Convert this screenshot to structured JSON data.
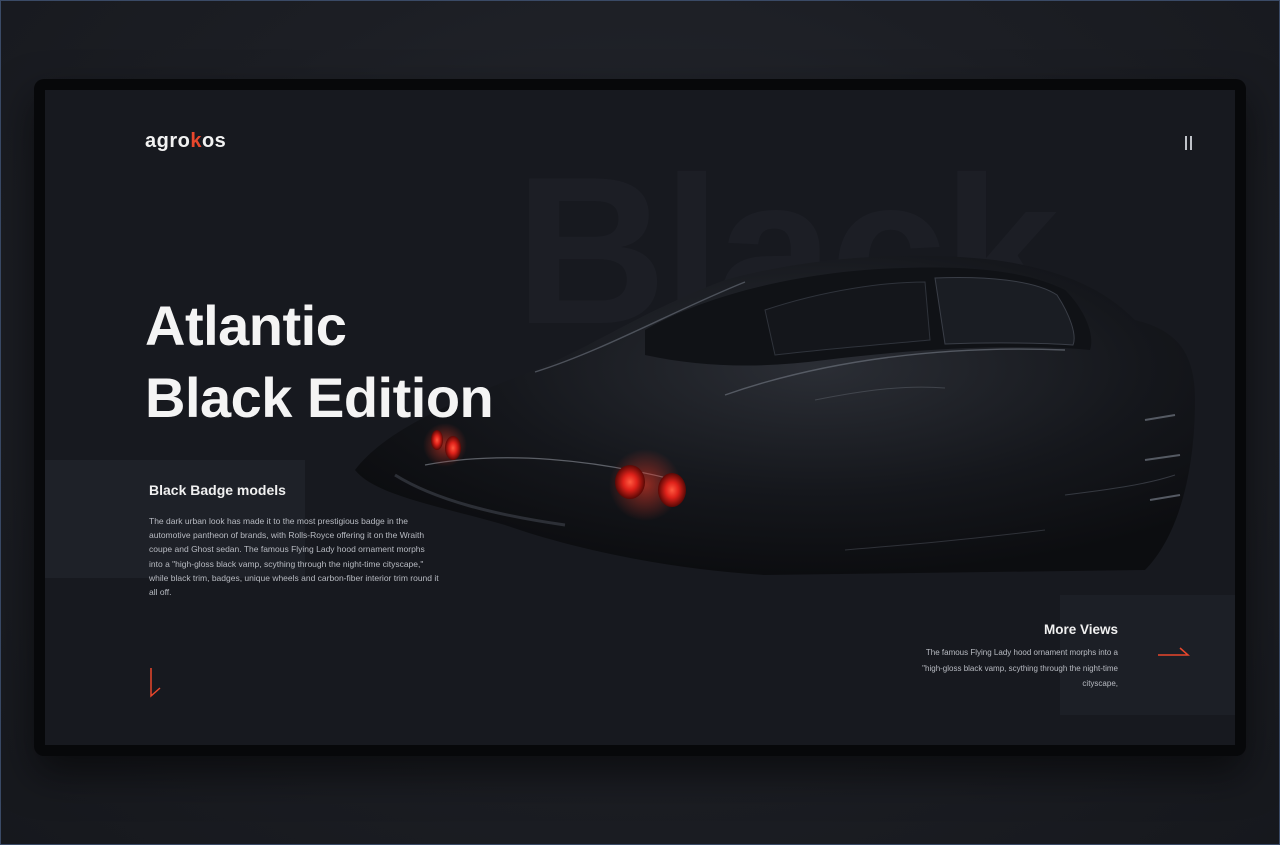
{
  "header": {
    "logo_prefix": "agro",
    "logo_accent": "k",
    "logo_suffix": "os",
    "menu_icon": "hamburger-vertical-icon"
  },
  "hero": {
    "watermark": "Black",
    "title_line1": "Atlantic",
    "title_line2": "Black Edition"
  },
  "badge_section": {
    "heading": "Black Badge models",
    "body": "The dark urban look has made it to the most prestigious badge in the automotive pantheon of brands, with Rolls-Royce offering it on the Wraith coupe and Ghost sedan. The famous Flying Lady hood ornament morphs into a \"high-gloss black vamp, scything through the night-time cityscape,\" while black trim, badges, unique wheels and carbon-fiber interior trim round it all off.",
    "scroll_icon": "arrow-down-icon"
  },
  "more_views": {
    "heading": "More Views",
    "body": "The famous Flying Lady hood ornament morphs into a \"high-gloss black vamp, scything through the night-time cityscape,",
    "arrow_icon": "arrow-right-icon"
  },
  "colors": {
    "accent": "#e8472c",
    "background": "#17191f",
    "text_primary": "#f4f4f4",
    "text_secondary": "#b8bbc2"
  }
}
